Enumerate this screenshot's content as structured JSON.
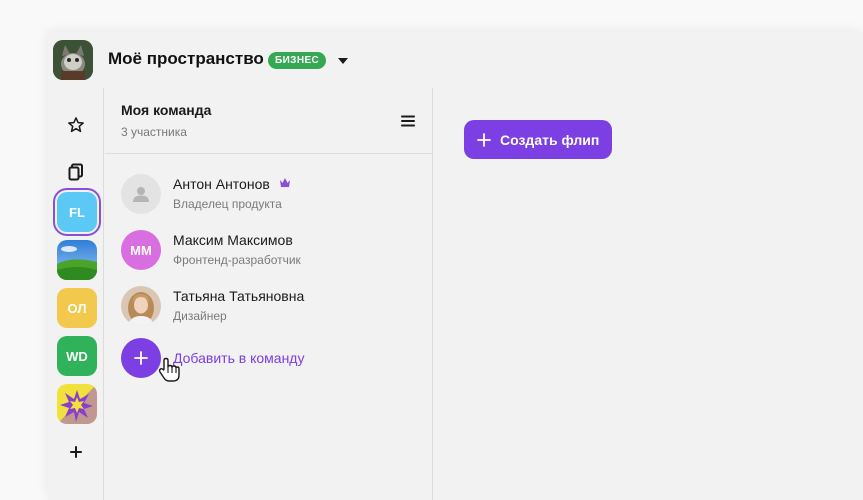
{
  "workspace": {
    "title": "Моё пространство",
    "badge": "БИЗНЕС",
    "avatar_icon": "cat-avatar-icon"
  },
  "rail": {
    "items": [
      {
        "name": "star-icon"
      },
      {
        "name": "copy-icon"
      },
      {
        "label": "FL",
        "color": "#5bc8f5",
        "active": true
      },
      {
        "label": "",
        "image": "landscape"
      },
      {
        "label": "ОЛ",
        "color": "#f2c94c"
      },
      {
        "label": "WD",
        "color": "#2fb25a"
      },
      {
        "label": "",
        "image": "burst"
      }
    ],
    "add_icon": "plus-icon"
  },
  "team": {
    "title": "Моя команда",
    "subtitle": "3 участника",
    "members": [
      {
        "name": "Антон Антонов",
        "role": "Владелец продукта",
        "avatar": "placeholder",
        "owner": true
      },
      {
        "name": "Максим Максимов",
        "role": "Фронтенд-разработчик",
        "initials": "ММ",
        "color": "#d86ee0"
      },
      {
        "name": "Татьяна Татьяновна",
        "role": "Дизайнер",
        "avatar": "photo"
      }
    ],
    "add_label": "Добавить в команду"
  },
  "main": {
    "create_label": "Создать флип"
  },
  "colors": {
    "accent": "#7b3fe4",
    "badge": "#34a853"
  }
}
